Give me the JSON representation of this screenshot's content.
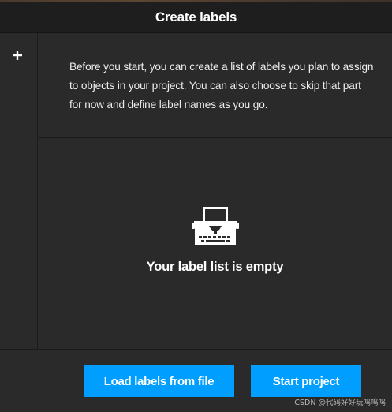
{
  "header": {
    "title": "Create labels"
  },
  "sidebar": {
    "add_icon": "plus-icon"
  },
  "intro": {
    "text": "Before you start, you can create a list of labels you plan to assign to objects in your project. You can also choose to skip that part for now and define label names as you go."
  },
  "empty_state": {
    "icon": "typewriter-icon",
    "message": "Your label list is empty"
  },
  "footer": {
    "load_label": "Load labels from file",
    "start_label": "Start project"
  },
  "watermark": {
    "text": "CSDN @代码好好玩呜呜呜"
  },
  "colors": {
    "accent": "#009fff",
    "header_bg": "#1e1e1e",
    "panel_bg": "#2a2a2a"
  }
}
